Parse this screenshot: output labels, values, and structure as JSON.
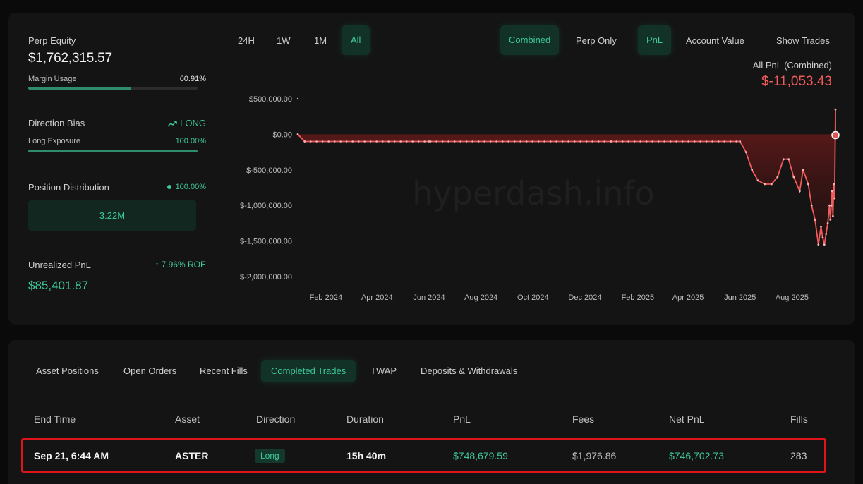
{
  "summary": {
    "perp_equity_label": "Perp Equity",
    "perp_equity_value": "$1,762,315.57",
    "margin_usage_label": "Margin Usage",
    "margin_usage_value": "60.91%",
    "margin_usage_fraction": 0.6091,
    "direction_bias_label": "Direction Bias",
    "direction_bias_value": "LONG",
    "long_exposure_label": "Long Exposure",
    "long_exposure_value": "100.00%",
    "long_exposure_fraction": 1.0,
    "position_distribution_label": "Position Distribution",
    "position_distribution_value": "100.00%",
    "position_distribution_amount": "3.22M",
    "unrealized_pnl_label": "Unrealized PnL",
    "unrealized_pnl_roe": "7.96% ROE",
    "unrealized_pnl_value": "$85,401.87"
  },
  "range_buttons": [
    "24H",
    "1W",
    "1M",
    "All"
  ],
  "range_active": "All",
  "mode_buttons": [
    "Combined",
    "Perp Only"
  ],
  "mode_active": "Combined",
  "metric_buttons": [
    "PnL",
    "Account Value"
  ],
  "metric_active": "PnL",
  "show_trades_label": "Show Trades",
  "pnl_header": {
    "label": "All PnL (Combined)",
    "value": "$-11,053.43"
  },
  "watermark": "hyperdash.info",
  "colors": {
    "accent_green": "#3ec99a",
    "loss_red": "#f05a5a",
    "highlight_red": "#e0141b"
  },
  "chart_data": {
    "type": "area",
    "title": "",
    "xlabel": "",
    "ylabel": "",
    "y_tick_labels": [
      "$500,000.00",
      "$0.00",
      "$-500,000.00",
      "$-1,000,000.00",
      "$-1,500,000.00",
      "$-2,000,000.00"
    ],
    "y_tick_values": [
      500000,
      0,
      -500000,
      -1000000,
      -1500000,
      -2000000
    ],
    "x_tick_labels": [
      "Feb 2024",
      "Apr 2024",
      "Jun 2024",
      "Aug 2024",
      "Oct 2024",
      "Dec 2024",
      "Feb 2025",
      "Apr 2025",
      "Jun 2025",
      "Aug 2025"
    ],
    "ylim": [
      -2000000,
      500000
    ],
    "grid": false,
    "legend": "none",
    "series": [
      {
        "x": [
          "2023-12-30",
          "2024-01-07",
          "2024-06-01",
          "2025-01-01",
          "2025-06-01",
          "2025-06-08",
          "2025-06-15",
          "2025-06-22",
          "2025-06-30",
          "2025-07-08",
          "2025-07-15",
          "2025-07-22",
          "2025-07-28",
          "2025-08-03",
          "2025-08-10",
          "2025-08-14",
          "2025-08-20",
          "2025-08-24",
          "2025-08-28",
          "2025-09-01",
          "2025-09-04",
          "2025-09-06",
          "2025-09-08",
          "2025-09-10",
          "2025-09-12",
          "2025-09-14",
          "2025-09-15",
          "2025-09-16",
          "2025-09-17",
          "2025-09-18",
          "2025-09-19",
          "2025-09-20",
          "2025-09-21",
          "2025-09-21"
        ],
        "y": [
          0,
          -100000,
          -100000,
          -100000,
          -100000,
          -250000,
          -500000,
          -650000,
          -700000,
          -700000,
          -600000,
          -350000,
          -350000,
          -600000,
          -800000,
          -500000,
          -700000,
          -1000000,
          -1200000,
          -1550000,
          -1300000,
          -1450000,
          -1550000,
          -1400000,
          -1250000,
          -1000000,
          -1200000,
          -1000000,
          -800000,
          -1150000,
          -700000,
          -900000,
          350000,
          -11053
        ]
      }
    ]
  },
  "tabs": [
    "Asset Positions",
    "Open Orders",
    "Recent Fills",
    "Completed Trades",
    "TWAP",
    "Deposits & Withdrawals"
  ],
  "tab_active": "Completed Trades",
  "table": {
    "columns": [
      "End Time",
      "Asset",
      "Direction",
      "Duration",
      "PnL",
      "Fees",
      "Net PnL",
      "Fills"
    ],
    "rows": [
      {
        "end_time": "Sep 21, 6:44 AM",
        "asset": "ASTER",
        "direction": "Long",
        "duration": "15h 40m",
        "pnl": "$748,679.59",
        "fees": "$1,976.86",
        "net_pnl": "$746,702.73",
        "fills": "283"
      }
    ]
  }
}
